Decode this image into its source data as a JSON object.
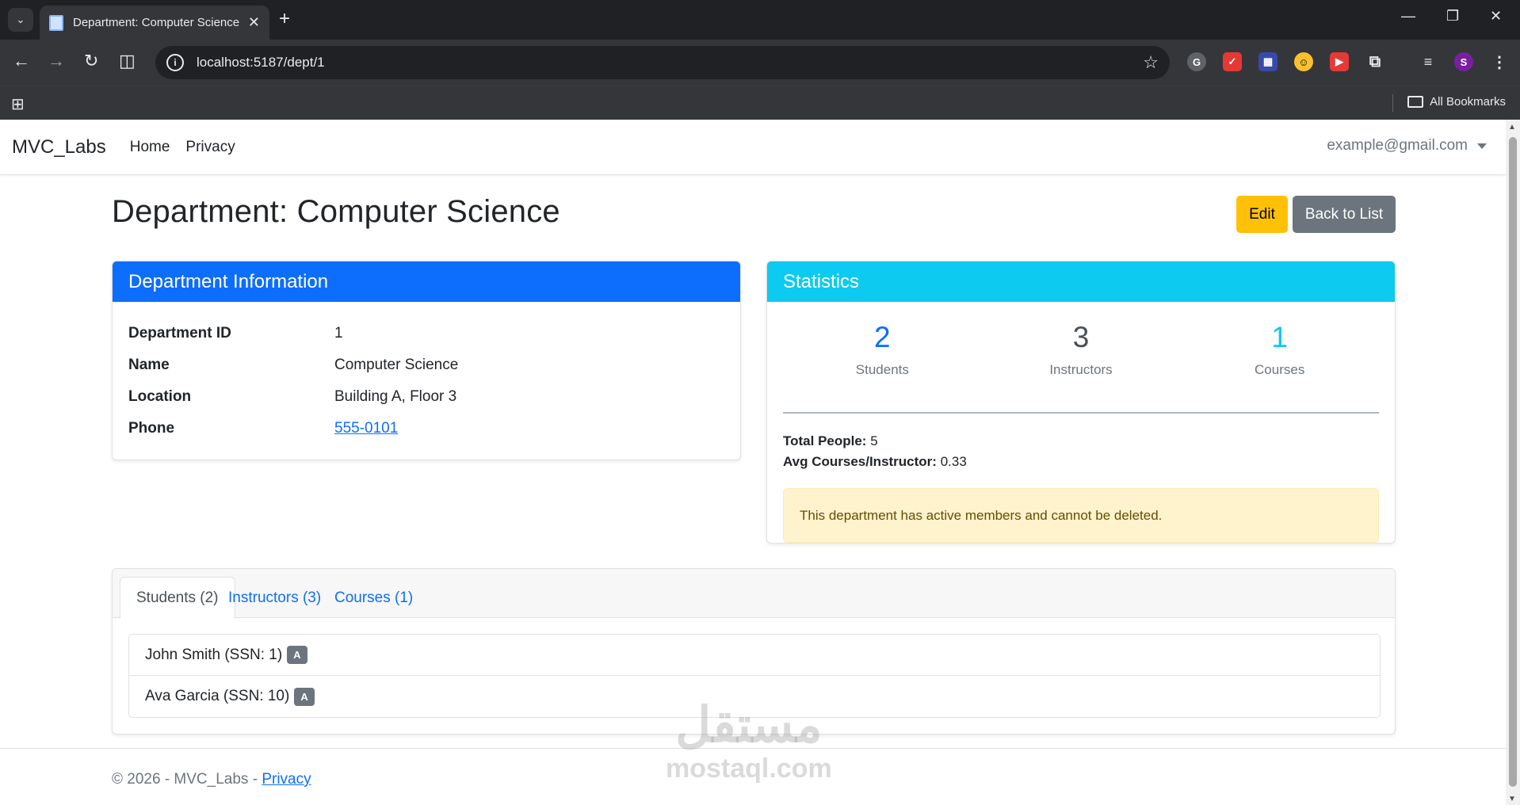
{
  "browser": {
    "tab_title": "Department: Computer Science",
    "url": "localhost:5187/dept/1",
    "bookmarks_label": "All Bookmarks",
    "profile_initial": "S"
  },
  "navbar": {
    "brand": "MVC_Labs",
    "links": [
      "Home",
      "Privacy"
    ],
    "user": "example@gmail.com"
  },
  "page": {
    "title": "Department: Computer Science",
    "edit_label": "Edit",
    "back_label": "Back to List"
  },
  "info": {
    "header": "Department Information",
    "rows": [
      {
        "key": "Department ID",
        "value": "1"
      },
      {
        "key": "Name",
        "value": "Computer Science"
      },
      {
        "key": "Location",
        "value": "Building A, Floor 3"
      },
      {
        "key": "Phone",
        "value": "555-0101"
      }
    ]
  },
  "stats": {
    "header": "Statistics",
    "items": [
      {
        "value": "2",
        "label": "Students",
        "color": "#0d6efd"
      },
      {
        "value": "3",
        "label": "Instructors",
        "color": "#495057"
      },
      {
        "value": "1",
        "label": "Courses",
        "color": "#0dcaf0"
      }
    ],
    "total_label": "Total People:",
    "total_value": "5",
    "avg_label": "Avg Courses/Instructor:",
    "avg_value": "0.33",
    "alert": "This department has active members and cannot be deleted."
  },
  "tabs": {
    "labels": [
      "Students (2)",
      "Instructors (3)",
      "Courses (1)"
    ],
    "students": [
      {
        "name": "John Smith (SSN: 1)",
        "badge": "A"
      },
      {
        "name": "Ava Garcia (SSN: 10)",
        "badge": "A"
      }
    ]
  },
  "footer": {
    "text": "© 2026 - MVC_Labs - ",
    "link": "Privacy"
  },
  "watermark": {
    "arabic": "مستقل",
    "latin": "mostaql.com"
  }
}
